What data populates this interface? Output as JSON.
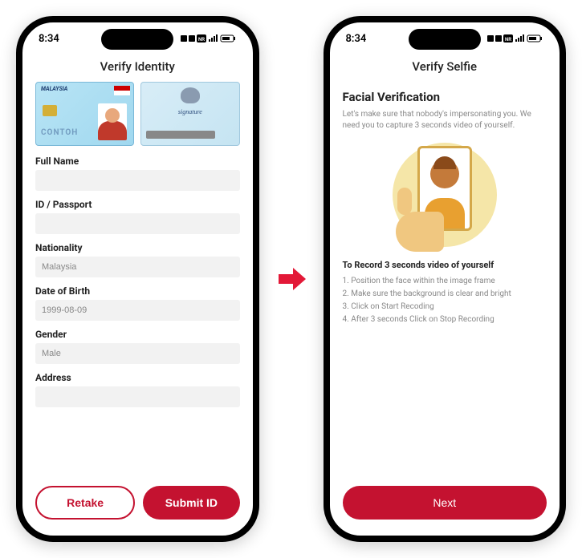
{
  "status": {
    "time": "8:34",
    "icons": "◉ ▦ ⬛ ▥ ▤"
  },
  "screen1": {
    "title": "Verify Identity",
    "id_watermark": "CONTOH",
    "fields": {
      "full_name": {
        "label": "Full Name",
        "value": ""
      },
      "id_passport": {
        "label": "ID / Passport",
        "value": ""
      },
      "nationality": {
        "label": "Nationality",
        "value": "Malaysia"
      },
      "dob": {
        "label": "Date of Birth",
        "value": "1999-08-09"
      },
      "gender": {
        "label": "Gender",
        "value": "Male"
      },
      "address": {
        "label": "Address",
        "value": ""
      }
    },
    "buttons": {
      "retake": "Retake",
      "submit": "Submit ID"
    }
  },
  "screen2": {
    "title": "Verify Selfie",
    "heading": "Facial Verification",
    "desc": "Let's make sure that nobody's impersonating you. We need you to capture 3 seconds video of yourself.",
    "sub_heading": "To Record 3 seconds video of yourself",
    "steps": [
      "Position the face within the image frame",
      "Make sure the background is clear and bright",
      "Click on Start Recoding",
      "After 3 seconds Click on Stop Recording"
    ],
    "next": "Next"
  }
}
